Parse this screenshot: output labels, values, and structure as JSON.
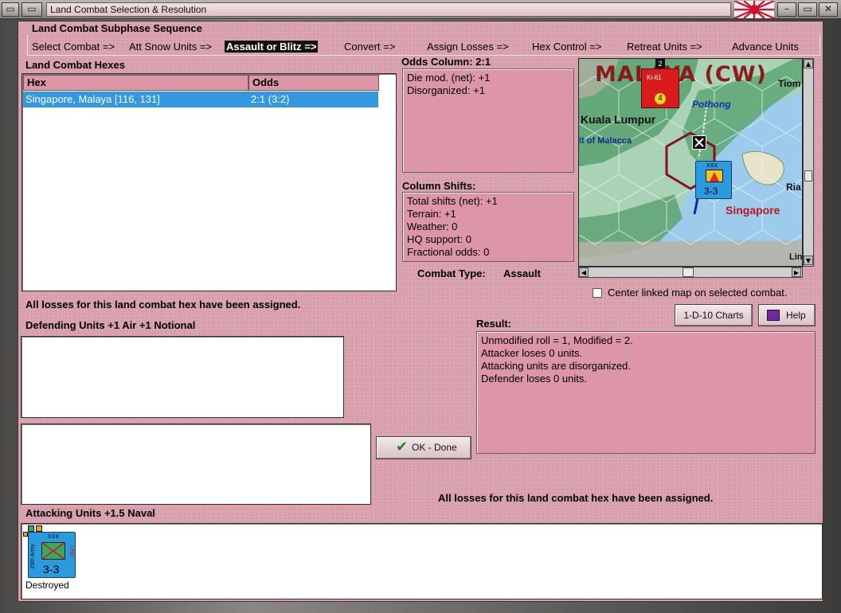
{
  "window": {
    "title": "Land Combat Selection & Resolution",
    "btn_left": "▭",
    "btn_minimize": "–",
    "btn_restore": "▭",
    "btn_close": "✕"
  },
  "sequence": {
    "legend": "Land Combat Subphase Sequence",
    "steps": [
      "Select Combat =>",
      "Att Snow Units =>",
      "Assault or Blitz =>",
      "Convert =>",
      "Assign Losses =>",
      "Hex Control =>",
      "Retreat Units =>",
      "Advance Units"
    ]
  },
  "hexes": {
    "title": "Land Combat Hexes",
    "columns": [
      "Hex",
      "Odds"
    ],
    "rows": [
      {
        "hex": "Singapore, Malaya [116, 131]",
        "odds": "2:1 (3:2)"
      }
    ]
  },
  "odds": {
    "title": "Odds Column: 2:1",
    "lines": [
      "Die mod. (net): +1",
      "Disorganized: +1"
    ]
  },
  "shifts": {
    "title": "Column Shifts:",
    "lines": [
      "Total shifts (net): +1",
      "Terrain: +1",
      "Weather: 0",
      "HQ support: 0",
      "Fractional odds: 0"
    ]
  },
  "combat_type": {
    "label": "Combat Type:",
    "value": "Assault"
  },
  "map": {
    "region_title": "MALAYA (CW)",
    "labels": {
      "kuala_lumpur": "Kuala Lumpur",
      "pothong": "Pothong",
      "strait": "it of Malacca",
      "singapore": "Singapore",
      "tiom": "Tiom",
      "ria": "Ria",
      "lin": "Lin"
    },
    "unit_top": {
      "strength": "4",
      "stack": "2",
      "label": "Ki-61"
    },
    "unit_def": {
      "value": "3-3",
      "size": "XXX"
    }
  },
  "center_linked": {
    "label": "Center linked map on selected combat.",
    "checked": false
  },
  "buttons": {
    "charts": "1-D-10 Charts",
    "help": "Help",
    "ok": "OK - Done"
  },
  "status_top": "All losses for this land combat hex have been assigned.",
  "status_bottom": "All losses for this land combat hex have been assigned.",
  "defending": {
    "title": "Defending Units +1 Air +1 Notional"
  },
  "result": {
    "title": "Result:",
    "lines": [
      "Unmodified roll = 1, Modified = 2.",
      "Attacker loses 0 units.",
      "Attacking units are disorganized.",
      "Defender loses 0 units."
    ]
  },
  "attacking": {
    "title": "Attacking Units +1.5 Naval",
    "units": [
      {
        "value": "3-3",
        "size": "XXX",
        "side": "25th Army",
        "status": "Destroyed",
        "tag": "UND"
      }
    ]
  },
  "colors": {
    "panel": "#d8a0ac",
    "selection": "#3398e0",
    "unit": "#2b9be0",
    "sea": "#a8d0f0",
    "land": "#3f8f5a"
  }
}
